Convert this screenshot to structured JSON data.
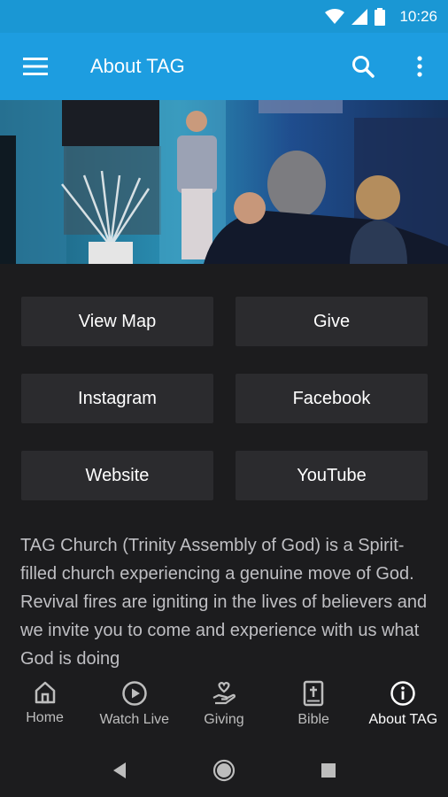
{
  "status_bar": {
    "time": "10:26"
  },
  "app_bar": {
    "title": "About TAG"
  },
  "buttons": {
    "view_map": "View Map",
    "give": "Give",
    "instagram": "Instagram",
    "facebook": "Facebook",
    "website": "Website",
    "youtube": "YouTube"
  },
  "about": {
    "text": "TAG Church (Trinity Assembly of God) is a Spirit-filled church experiencing a genuine move of God. Revival fires are igniting in the lives of believers and we invite you to come and experience with us what God is doing"
  },
  "bottom_nav": {
    "items": [
      {
        "label": "Home",
        "icon": "home-icon"
      },
      {
        "label": "Watch Live",
        "icon": "play-circle-icon"
      },
      {
        "label": "Giving",
        "icon": "hand-heart-icon"
      },
      {
        "label": "Bible",
        "icon": "bible-icon"
      },
      {
        "label": "About TAG",
        "icon": "info-icon"
      }
    ],
    "active_index": 4
  },
  "colors": {
    "status_bar": "#1a97d4",
    "app_bar": "#1d9de0",
    "background": "#1c1c1e",
    "button": "#2b2b2e"
  }
}
